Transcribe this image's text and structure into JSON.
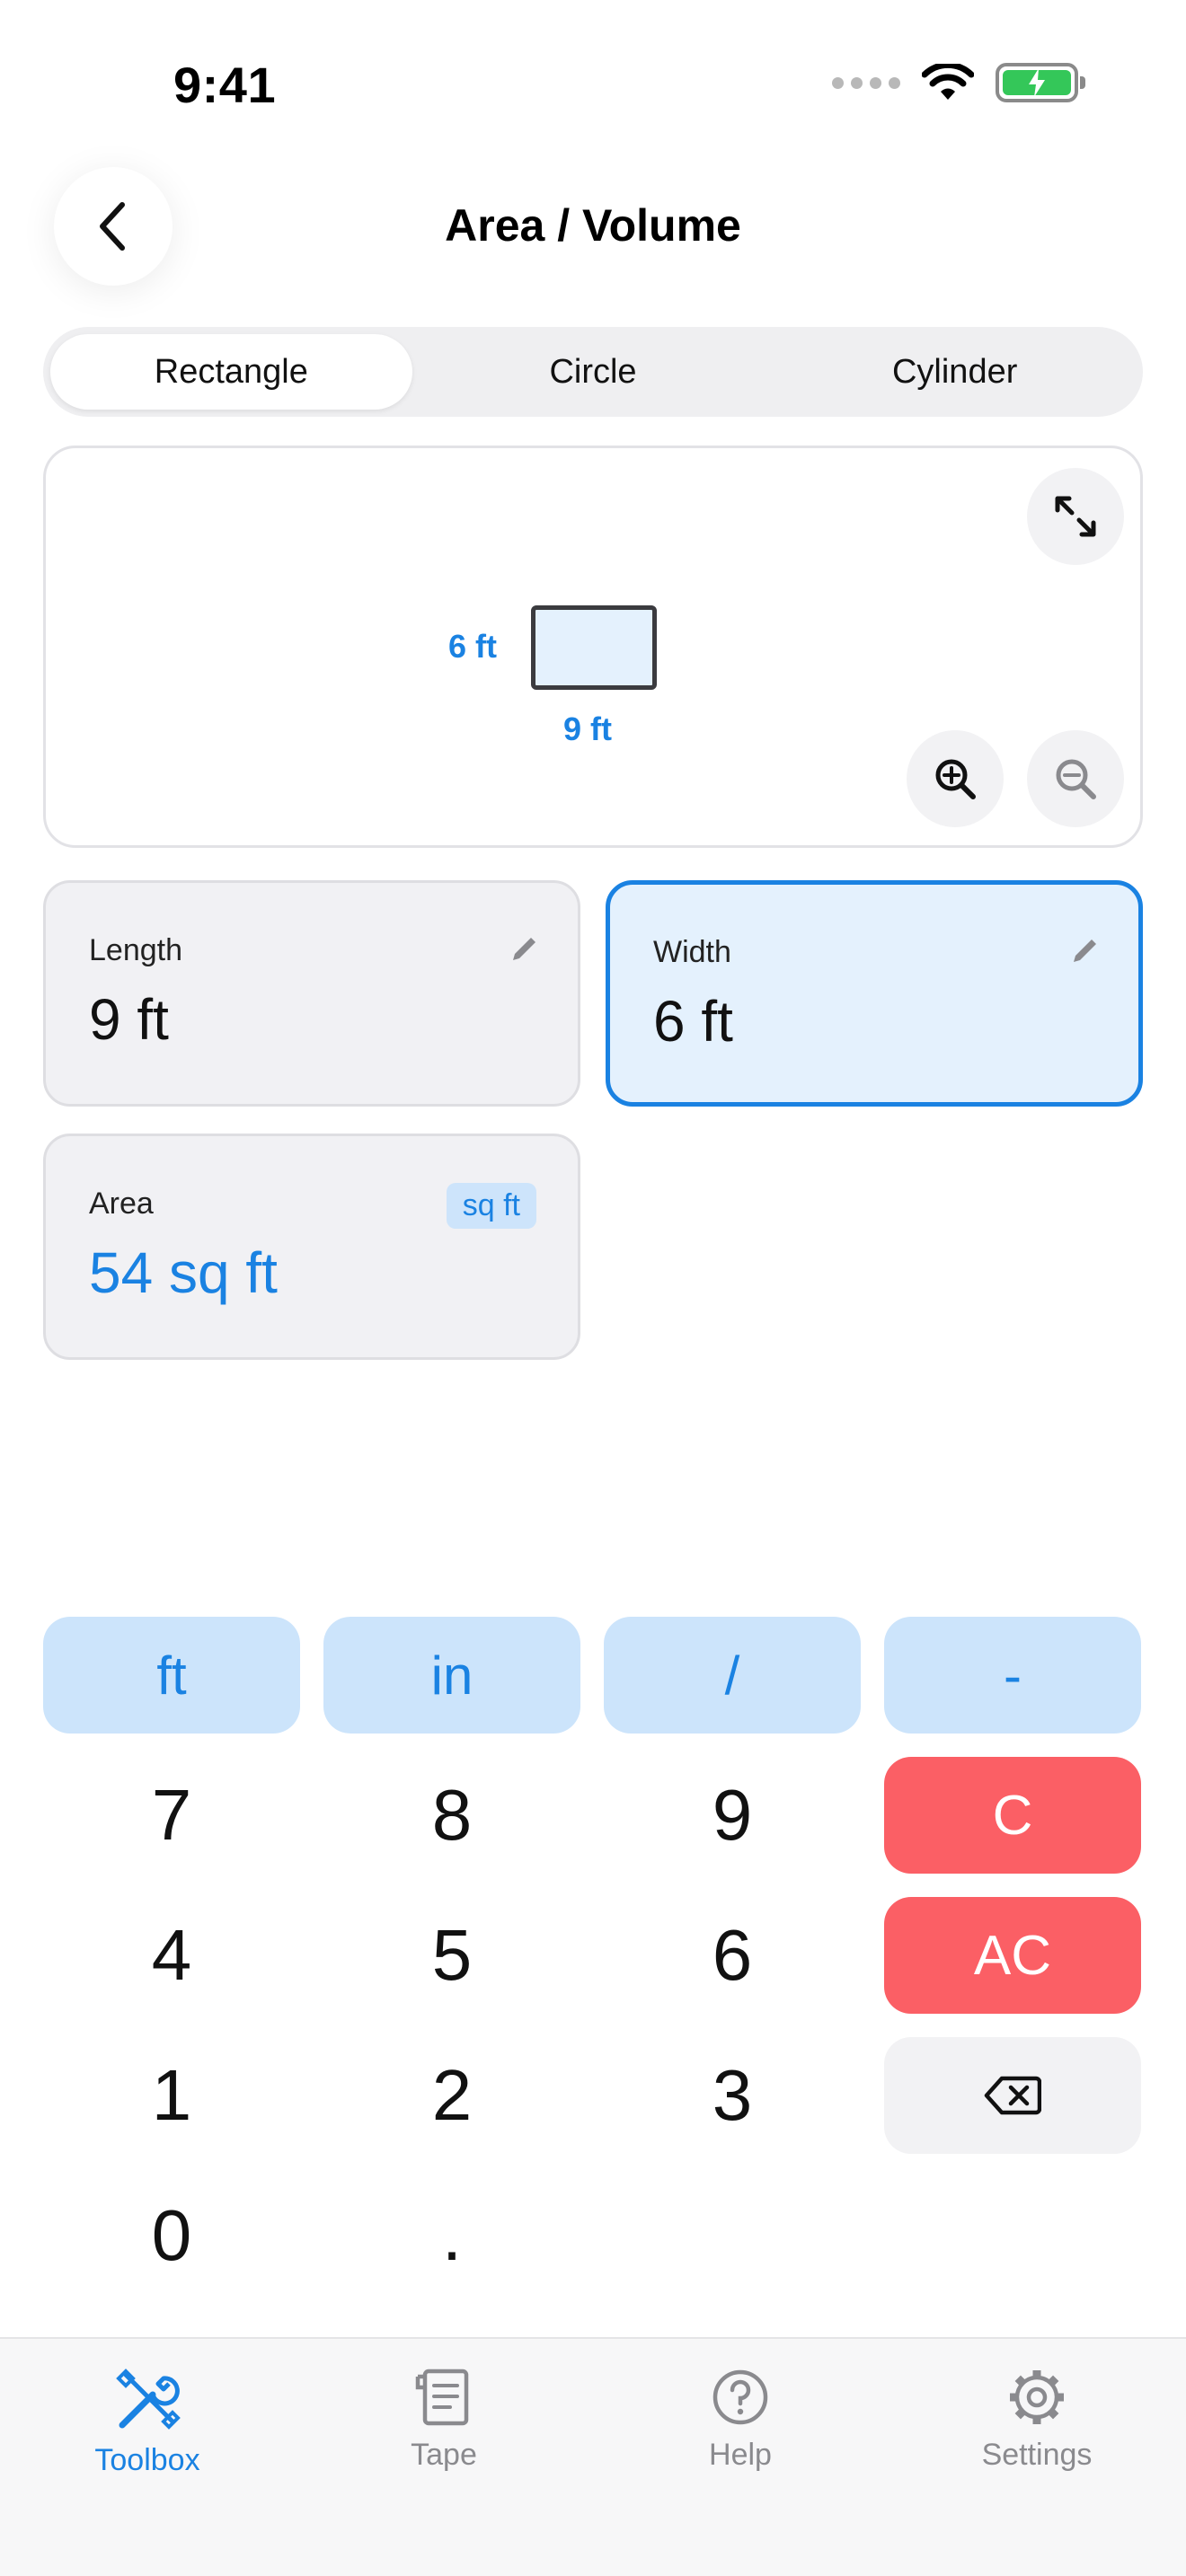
{
  "status_bar": {
    "time": "9:41"
  },
  "header": {
    "title": "Area / Volume"
  },
  "tabs": [
    {
      "label": "Rectangle",
      "active": true
    },
    {
      "label": "Circle",
      "active": false
    },
    {
      "label": "Cylinder",
      "active": false
    }
  ],
  "diagram": {
    "width_label": "6 ft",
    "length_label": "9 ft"
  },
  "fields": {
    "length": {
      "label": "Length",
      "value": "9 ft"
    },
    "width": {
      "label": "Width",
      "value": "6 ft"
    },
    "area": {
      "label": "Area",
      "unit": "sq ft",
      "value": "54 sq ft"
    }
  },
  "keypad": {
    "units": [
      "ft",
      "in",
      "/",
      "-"
    ],
    "numbers": [
      "7",
      "8",
      "9",
      "4",
      "5",
      "6",
      "1",
      "2",
      "3",
      "0",
      "."
    ],
    "clear": "C",
    "all_clear": "AC"
  },
  "tabbar": {
    "items": [
      {
        "label": "Toolbox",
        "icon": "toolbox-icon",
        "active": true
      },
      {
        "label": "Tape",
        "icon": "tape-icon",
        "active": false
      },
      {
        "label": "Help",
        "icon": "help-icon",
        "active": false
      },
      {
        "label": "Settings",
        "icon": "settings-icon",
        "active": false
      }
    ]
  },
  "colors": {
    "accent": "#1a82e2",
    "danger": "#fb5f65",
    "unit_key": "#cce4fb"
  }
}
